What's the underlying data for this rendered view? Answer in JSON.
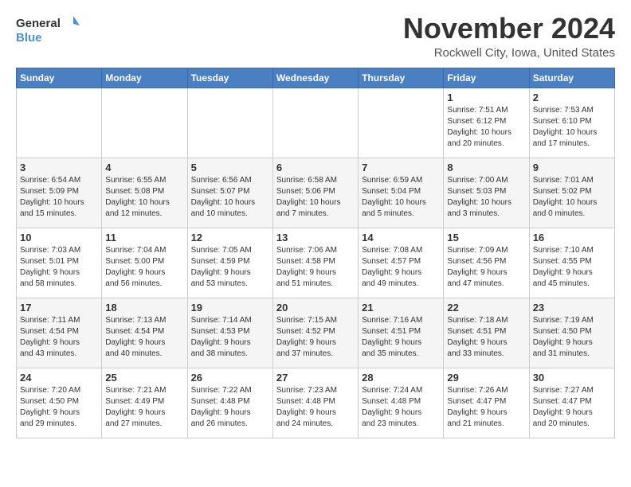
{
  "logo": {
    "general": "General",
    "blue": "Blue"
  },
  "header": {
    "month": "November 2024",
    "location": "Rockwell City, Iowa, United States"
  },
  "weekdays": [
    "Sunday",
    "Monday",
    "Tuesday",
    "Wednesday",
    "Thursday",
    "Friday",
    "Saturday"
  ],
  "weeks": [
    [
      {
        "day": "",
        "info": ""
      },
      {
        "day": "",
        "info": ""
      },
      {
        "day": "",
        "info": ""
      },
      {
        "day": "",
        "info": ""
      },
      {
        "day": "",
        "info": ""
      },
      {
        "day": "1",
        "info": "Sunrise: 7:51 AM\nSunset: 6:12 PM\nDaylight: 10 hours\nand 20 minutes."
      },
      {
        "day": "2",
        "info": "Sunrise: 7:53 AM\nSunset: 6:10 PM\nDaylight: 10 hours\nand 17 minutes."
      }
    ],
    [
      {
        "day": "3",
        "info": "Sunrise: 6:54 AM\nSunset: 5:09 PM\nDaylight: 10 hours\nand 15 minutes."
      },
      {
        "day": "4",
        "info": "Sunrise: 6:55 AM\nSunset: 5:08 PM\nDaylight: 10 hours\nand 12 minutes."
      },
      {
        "day": "5",
        "info": "Sunrise: 6:56 AM\nSunset: 5:07 PM\nDaylight: 10 hours\nand 10 minutes."
      },
      {
        "day": "6",
        "info": "Sunrise: 6:58 AM\nSunset: 5:06 PM\nDaylight: 10 hours\nand 7 minutes."
      },
      {
        "day": "7",
        "info": "Sunrise: 6:59 AM\nSunset: 5:04 PM\nDaylight: 10 hours\nand 5 minutes."
      },
      {
        "day": "8",
        "info": "Sunrise: 7:00 AM\nSunset: 5:03 PM\nDaylight: 10 hours\nand 3 minutes."
      },
      {
        "day": "9",
        "info": "Sunrise: 7:01 AM\nSunset: 5:02 PM\nDaylight: 10 hours\nand 0 minutes."
      }
    ],
    [
      {
        "day": "10",
        "info": "Sunrise: 7:03 AM\nSunset: 5:01 PM\nDaylight: 9 hours\nand 58 minutes."
      },
      {
        "day": "11",
        "info": "Sunrise: 7:04 AM\nSunset: 5:00 PM\nDaylight: 9 hours\nand 56 minutes."
      },
      {
        "day": "12",
        "info": "Sunrise: 7:05 AM\nSunset: 4:59 PM\nDaylight: 9 hours\nand 53 minutes."
      },
      {
        "day": "13",
        "info": "Sunrise: 7:06 AM\nSunset: 4:58 PM\nDaylight: 9 hours\nand 51 minutes."
      },
      {
        "day": "14",
        "info": "Sunrise: 7:08 AM\nSunset: 4:57 PM\nDaylight: 9 hours\nand 49 minutes."
      },
      {
        "day": "15",
        "info": "Sunrise: 7:09 AM\nSunset: 4:56 PM\nDaylight: 9 hours\nand 47 minutes."
      },
      {
        "day": "16",
        "info": "Sunrise: 7:10 AM\nSunset: 4:55 PM\nDaylight: 9 hours\nand 45 minutes."
      }
    ],
    [
      {
        "day": "17",
        "info": "Sunrise: 7:11 AM\nSunset: 4:54 PM\nDaylight: 9 hours\nand 43 minutes."
      },
      {
        "day": "18",
        "info": "Sunrise: 7:13 AM\nSunset: 4:54 PM\nDaylight: 9 hours\nand 40 minutes."
      },
      {
        "day": "19",
        "info": "Sunrise: 7:14 AM\nSunset: 4:53 PM\nDaylight: 9 hours\nand 38 minutes."
      },
      {
        "day": "20",
        "info": "Sunrise: 7:15 AM\nSunset: 4:52 PM\nDaylight: 9 hours\nand 37 minutes."
      },
      {
        "day": "21",
        "info": "Sunrise: 7:16 AM\nSunset: 4:51 PM\nDaylight: 9 hours\nand 35 minutes."
      },
      {
        "day": "22",
        "info": "Sunrise: 7:18 AM\nSunset: 4:51 PM\nDaylight: 9 hours\nand 33 minutes."
      },
      {
        "day": "23",
        "info": "Sunrise: 7:19 AM\nSunset: 4:50 PM\nDaylight: 9 hours\nand 31 minutes."
      }
    ],
    [
      {
        "day": "24",
        "info": "Sunrise: 7:20 AM\nSunset: 4:50 PM\nDaylight: 9 hours\nand 29 minutes."
      },
      {
        "day": "25",
        "info": "Sunrise: 7:21 AM\nSunset: 4:49 PM\nDaylight: 9 hours\nand 27 minutes."
      },
      {
        "day": "26",
        "info": "Sunrise: 7:22 AM\nSunset: 4:48 PM\nDaylight: 9 hours\nand 26 minutes."
      },
      {
        "day": "27",
        "info": "Sunrise: 7:23 AM\nSunset: 4:48 PM\nDaylight: 9 hours\nand 24 minutes."
      },
      {
        "day": "28",
        "info": "Sunrise: 7:24 AM\nSunset: 4:48 PM\nDaylight: 9 hours\nand 23 minutes."
      },
      {
        "day": "29",
        "info": "Sunrise: 7:26 AM\nSunset: 4:47 PM\nDaylight: 9 hours\nand 21 minutes."
      },
      {
        "day": "30",
        "info": "Sunrise: 7:27 AM\nSunset: 4:47 PM\nDaylight: 9 hours\nand 20 minutes."
      }
    ]
  ]
}
